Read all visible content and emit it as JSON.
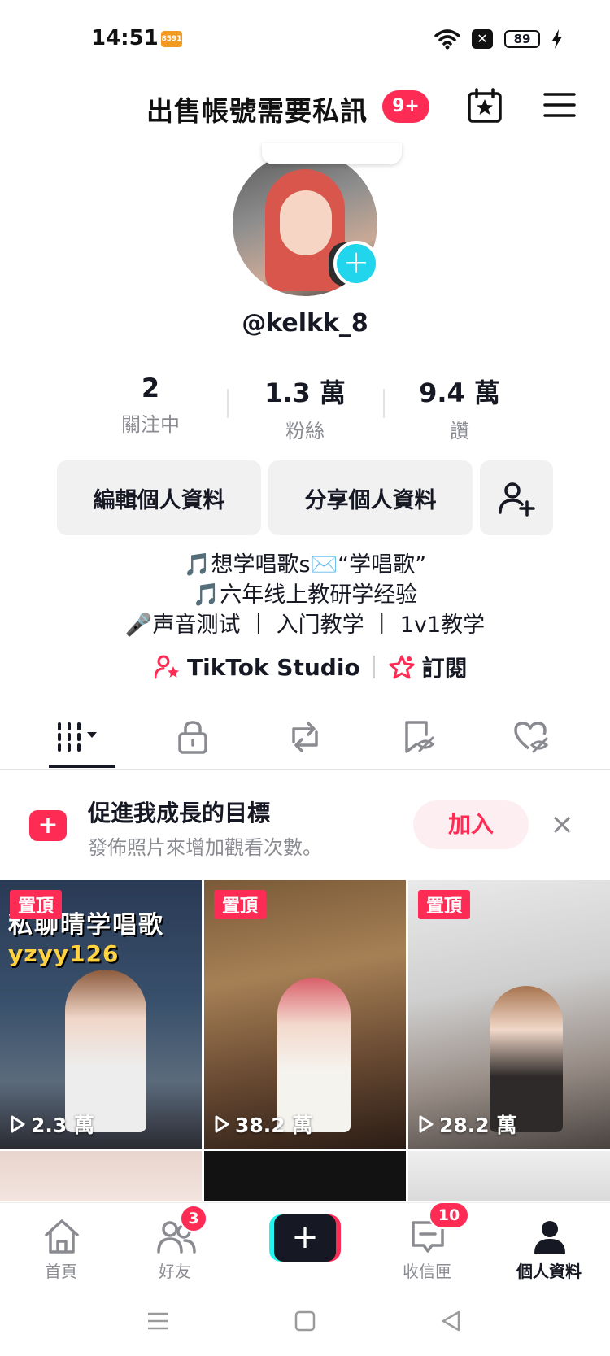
{
  "status_bar": {
    "time": "14:51",
    "app_badge": "8591",
    "battery": "89"
  },
  "header": {
    "title": "出售帳號需要私訊",
    "notification_count": "9+"
  },
  "profile": {
    "username": "@kelkk_8",
    "stats": [
      {
        "value": "2",
        "label": "關注中"
      },
      {
        "value": "1.3 萬",
        "label": "粉絲"
      },
      {
        "value": "9.4 萬",
        "label": "讚"
      }
    ],
    "edit_button": "編輯個人資料",
    "share_button": "分享個人資料",
    "bio": [
      "🎵想学唱歌s✉️“学唱歌”",
      "🎵六年线上教研学经验",
      "🎤声音测试 ｜ 入门教学 ｜ 1v1教学"
    ],
    "links": {
      "studio": "TikTok Studio",
      "subscribe": "訂閱"
    }
  },
  "growth": {
    "title": "促進我成長的目標",
    "subtitle": "發佈照片來增加觀看次數。",
    "join_button": "加入",
    "close": "×"
  },
  "videos": [
    {
      "pinned_label": "置頂",
      "plays": "2.3 萬",
      "overlay_title": "私聊晴学唱歌",
      "overlay_handle": "yzyy126"
    },
    {
      "pinned_label": "置頂",
      "plays": "38.2 萬"
    },
    {
      "pinned_label": "置頂",
      "plays": "28.2 萬"
    }
  ],
  "bottom_nav": {
    "home": "首頁",
    "friends": "好友",
    "friends_badge": "3",
    "inbox": "收信匣",
    "inbox_badge": "10",
    "profile": "個人資料"
  },
  "colors": {
    "brand_red": "#fe2c55",
    "brand_cyan": "#25f4ee",
    "text_primary": "#161823",
    "text_secondary": "#8a8b91"
  }
}
